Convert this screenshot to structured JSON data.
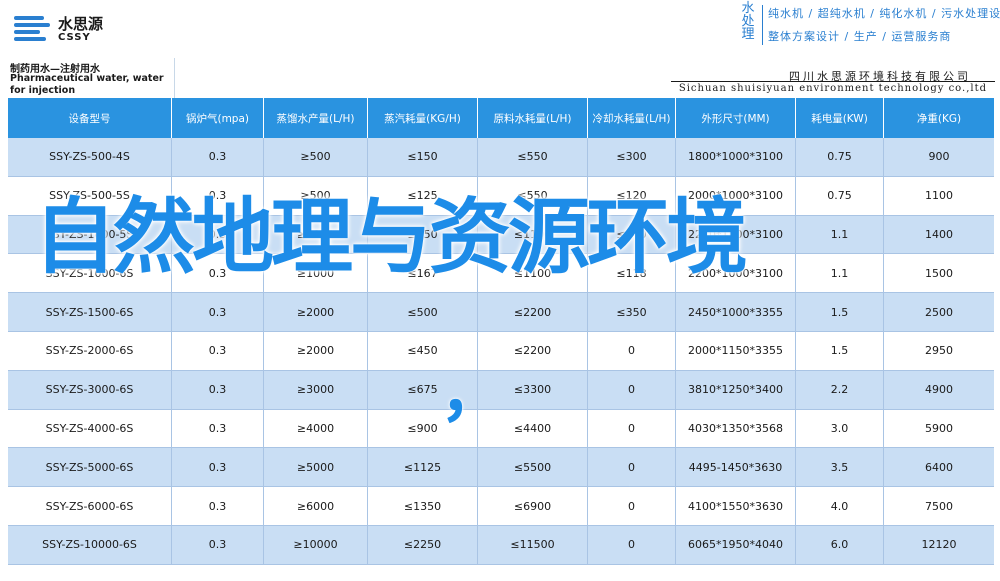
{
  "brand": {
    "logo_cn": "水思源",
    "logo_en": "CSSY",
    "vertical": [
      "水",
      "处",
      "理"
    ],
    "line1": "纯水机 / 超纯水机 / 纯化水机 / 污水处理设备",
    "line2": "整体方案设计 / 生产 / 运营服务商"
  },
  "table_title": {
    "cn": "制药用水—注射用水",
    "en": "Pharmaceutical water, water for injection"
  },
  "company": {
    "cn": "四川水思源环境科技有限公司",
    "en": "Sichuan shuisiyuan environment technology co.,ltd"
  },
  "headers": [
    "设备型号",
    "锅炉气(mpa)",
    "蒸馏水产量(L/H)",
    "蒸汽耗量(KG/H)",
    "原料水耗量(L/H)",
    "冷却水耗量(L/H)",
    "外形尺寸(MM)",
    "耗电量(KW)",
    "净重(KG)"
  ],
  "rows": [
    [
      "SSY-ZS-500-4S",
      "0.3",
      "≥500",
      "≤150",
      "≤550",
      "≤300",
      "1800*1000*3100",
      "0.75",
      "900"
    ],
    [
      "SSY-ZS-500-5S",
      "0.3",
      "≥500",
      "≤125",
      "≤550",
      "≤120",
      "2000*1000*3100",
      "0.75",
      "1100"
    ],
    [
      "SSY-ZS-1000-5S",
      "0.3",
      "≥1000",
      "≤250",
      "≤1100",
      "≤240",
      "2200*1000*3100",
      "1.1",
      "1400"
    ],
    [
      "SSY-ZS-1000-6S",
      "0.3",
      "≥1000",
      "≤167",
      "≤1100",
      "≤118",
      "2200*1000*3100",
      "1.1",
      "1500"
    ],
    [
      "SSY-ZS-1500-6S",
      "0.3",
      "≥2000",
      "≤500",
      "≤2200",
      "≤350",
      "2450*1000*3355",
      "1.5",
      "2500"
    ],
    [
      "SSY-ZS-2000-6S",
      "0.3",
      "≥2000",
      "≤450",
      "≤2200",
      "0",
      "2000*1150*3355",
      "1.5",
      "2950"
    ],
    [
      "SSY-ZS-3000-6S",
      "0.3",
      "≥3000",
      "≤675",
      "≤3300",
      "0",
      "3810*1250*3400",
      "2.2",
      "4900"
    ],
    [
      "SSY-ZS-4000-6S",
      "0.3",
      "≥4000",
      "≤900",
      "≤4400",
      "0",
      "4030*1350*3568",
      "3.0",
      "5900"
    ],
    [
      "SSY-ZS-5000-6S",
      "0.3",
      "≥5000",
      "≤1125",
      "≤5500",
      "0",
      "4495-1450*3630",
      "3.5",
      "6400"
    ],
    [
      "SSY-ZS-6000-6S",
      "0.3",
      "≥6000",
      "≤1350",
      "≤6900",
      "0",
      "4100*1550*3630",
      "4.0",
      "7500"
    ],
    [
      "SSY-ZS-10000-6S",
      "0.3",
      "≥10000",
      "≤2250",
      "≤11500",
      "0",
      "6065*1950*4040",
      "6.0",
      "12120"
    ]
  ],
  "overlay": {
    "title": "自然地理与资源环境",
    "punct": "，"
  },
  "colors": {
    "accent": "#2a93e0",
    "row_alt": "#c9def4",
    "overlay": "#1d8ce8"
  }
}
